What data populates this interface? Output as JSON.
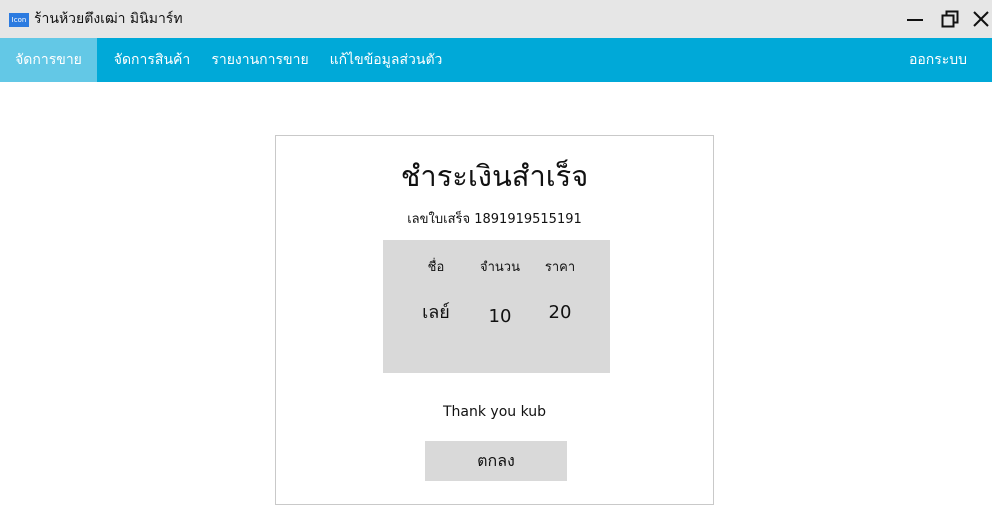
{
  "window": {
    "app_icon_label": "Icon",
    "title": "ร้านห้วยตึงเฒ่า มินิมาร์ท",
    "minimize_icon": "minimize-icon",
    "restore_icon": "restore-icon",
    "close_icon": "close-icon"
  },
  "nav": {
    "items": [
      {
        "label": "จัดการขาย",
        "active": true
      },
      {
        "label": "จัดการสินค้า",
        "active": false
      },
      {
        "label": "รายงานการขาย",
        "active": false
      },
      {
        "label": "แก้ไขข้อมูลส่วนตัว",
        "active": false
      }
    ],
    "logout_label": "ออกระบบ"
  },
  "receipt": {
    "title": "ชำระเงินสำเร็จ",
    "receipt_number_line": "เลขใบเสร็จ 1891919515191",
    "columns": [
      "ชื่อ",
      "จำนวน",
      "ราคา"
    ],
    "rows": [
      [
        "เลย์",
        "10",
        "20"
      ]
    ],
    "thank_you": "Thank you kub",
    "ok_label": "ตกลง"
  },
  "colors": {
    "titlebar_bg": "#e6e6e6",
    "nav_bg": "#00a9d8",
    "nav_active_bg": "#63c8e6",
    "panel_bg": "#d9d9d9"
  }
}
